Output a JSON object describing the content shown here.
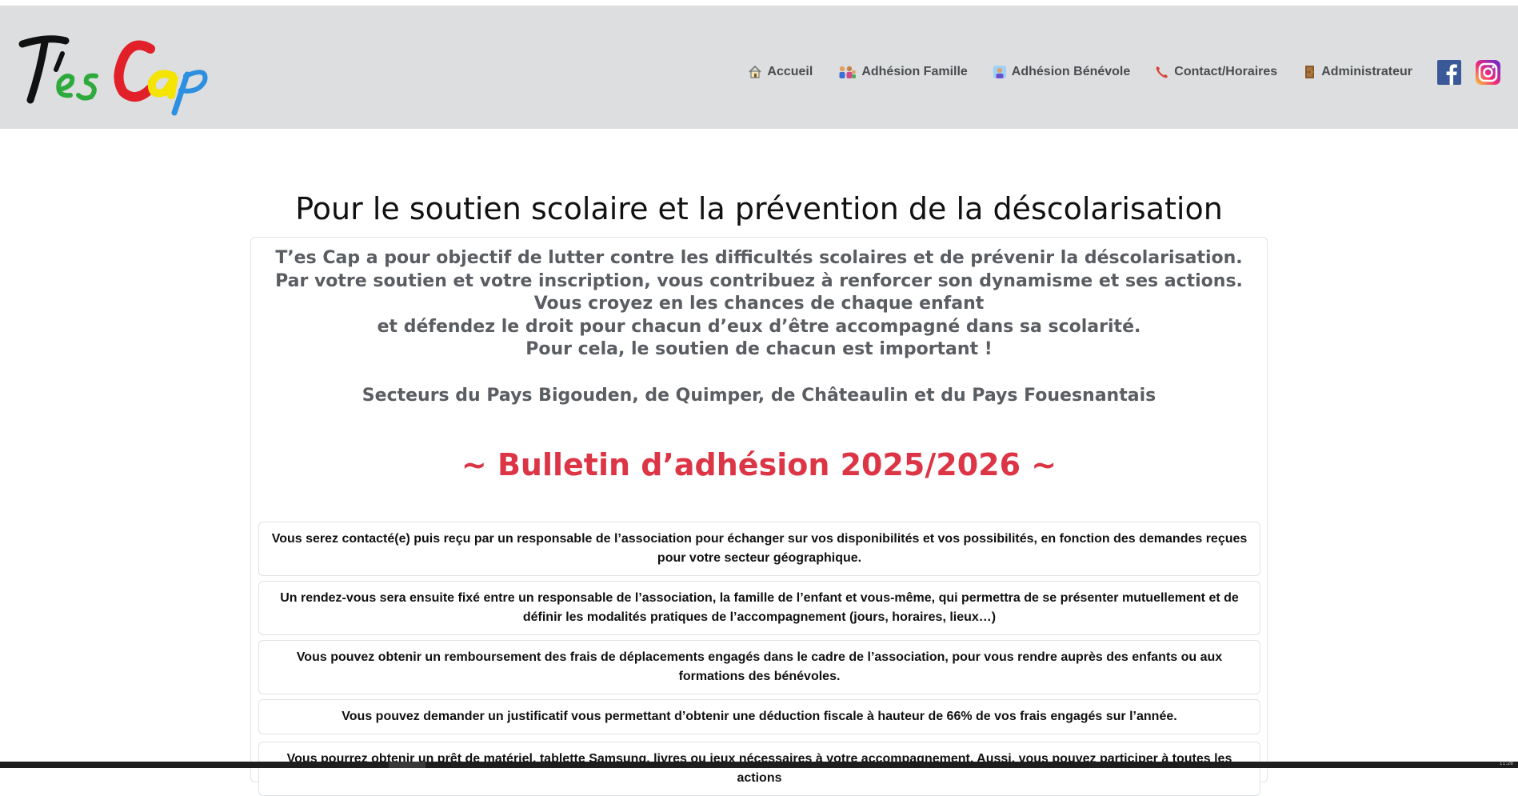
{
  "brand": {
    "logo_text": "T'es Cap"
  },
  "nav": {
    "items": [
      {
        "label": "Accueil",
        "icon": "house-icon"
      },
      {
        "label": "Adhésion Famille",
        "icon": "family-icon"
      },
      {
        "label": "Adhésion Bénévole",
        "icon": "volunteer-icon"
      },
      {
        "label": "Contact/Horaires",
        "icon": "phone-icon"
      },
      {
        "label": "Administrateur",
        "icon": "door-icon"
      }
    ],
    "social": [
      "facebook-icon",
      "instagram-icon"
    ]
  },
  "main": {
    "headline": "Pour le soutien scolaire et la prévention de la déscolarisation",
    "intro_lines": [
      "T’es Cap a pour objectif de lutter contre les difficultés scolaires et de prévenir la déscolarisation.",
      "Par votre soutien et votre inscription, vous contribuez à renforcer son dynamisme et ses actions.",
      "Vous croyez en les chances de chaque enfant",
      "et défendez le droit pour chacun d’eux d’être accompagné dans sa scolarité.",
      "Pour cela, le soutien de chacun est important !"
    ],
    "sectors": "Secteurs du Pays Bigouden, de Quimper, de Châteaulin et du Pays Fouesnantais",
    "bulletin_title": "~ Bulletin d’adhésion 2025/2026 ~",
    "info_items": [
      "Vous serez contacté(e) puis reçu par un responsable de l’association pour échanger sur vos disponibilités et vos possibilités, en fonction des demandes reçues pour votre secteur géographique.",
      "Un rendez-vous sera ensuite fixé entre un responsable de l’association, la famille de l’enfant et vous-même, qui permettra de se présenter mutuellement et de définir les modalités pratiques de l’accompagnement (jours, horaires, lieux…)",
      "Vous pouvez obtenir un remboursement des frais de déplacements engagés dans le cadre de l’association, pour vous rendre auprès des enfants ou aux formations des bénévoles.",
      "Vous pouvez demander un justificatif vous permettant d’obtenir une déduction fiscale à hauteur de 66% de vos frais engagés sur l’année.",
      "Vous pourrez obtenir un prêt de matériel, tablette Samsung, livres ou jeux nécessaires à votre accompagnement. Aussi, vous pouvez participer à toutes les actions"
    ]
  },
  "colors": {
    "navbar_bg": "#dcdedf",
    "accent_red": "#dc3545",
    "text_gray": "#5a5d61",
    "logo_black": "#111111",
    "logo_green": "#2eaa3c",
    "logo_red": "#e2202a",
    "logo_yellow": "#f5e400",
    "logo_blue": "#2d8fe0"
  },
  "taskbar": {
    "time": "11:28"
  }
}
